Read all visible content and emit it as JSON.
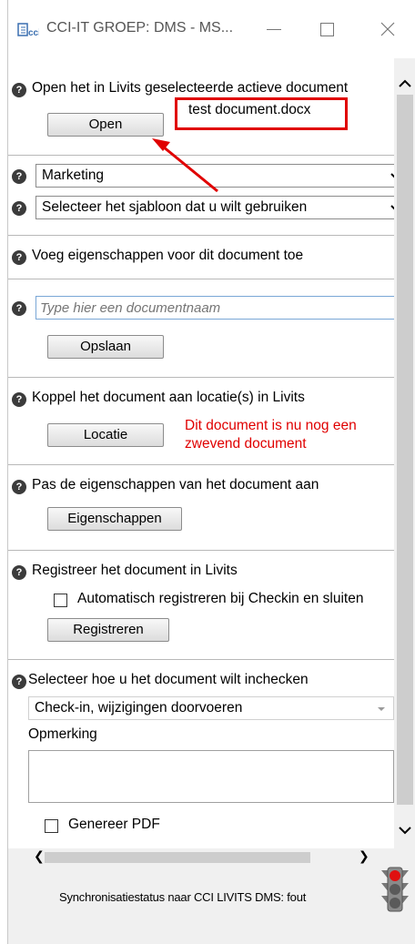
{
  "window": {
    "title": "CCI-IT GROEP: DMS - MS...",
    "minimize_glyph": "—",
    "maximize_glyph": "☐",
    "close_glyph": "✕"
  },
  "open_section": {
    "label": "Open het in Livits geselecteerde actieve document",
    "button": "Open",
    "callout_text": "test document.docx"
  },
  "department_select": {
    "value": "Marketing"
  },
  "template_select": {
    "value": "Selecteer het sjabloon dat u wilt gebruiken"
  },
  "properties_section": {
    "label": "Voeg eigenschappen voor dit document toe"
  },
  "name_section": {
    "placeholder": "Type hier een documentnaam",
    "save_button": "Opslaan"
  },
  "location_section": {
    "label": "Koppel het document aan locatie(s) in Livits",
    "button": "Locatie",
    "warning_line1": "Dit document is nu nog een",
    "warning_line2": "zwevend document"
  },
  "edit_properties_section": {
    "label": "Pas de eigenschappen van het document aan",
    "button": "Eigenschappen"
  },
  "register_section": {
    "label": "Registreer het document in Livits",
    "checkbox_label": "Automatisch registreren bij Checkin en sluiten",
    "checked": false,
    "button": "Registreren"
  },
  "checkin_section": {
    "label": "Selecteer hoe u het document wilt inchecken",
    "select_value": "Check-in, wijzigingen doorvoeren",
    "remark_label": "Opmerking",
    "remark_value": "",
    "pdf_checkbox_label": "Genereer PDF",
    "pdf_checked": false
  },
  "status_bar": {
    "text": "Synchronisatiestatus naar CCI LIVITS DMS: fout",
    "traffic_light_state": "red"
  },
  "help_icon_glyph": "?",
  "scroll_glyphs": {
    "left": "❮",
    "right": "❯"
  },
  "colors": {
    "accent_red": "#e00000",
    "panel": "#f0f0f0"
  }
}
